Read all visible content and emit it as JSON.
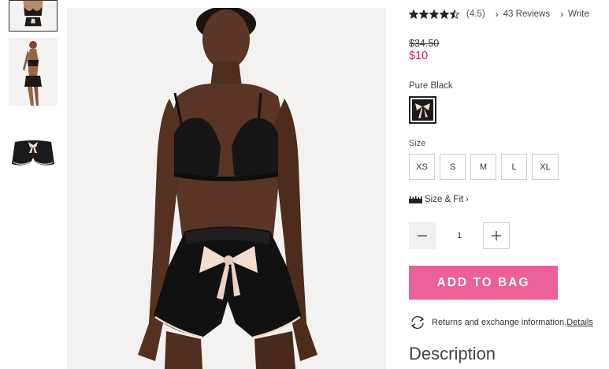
{
  "rating": {
    "value_text": "(4.5)",
    "value": 4.5,
    "reviews_label": "43 Reviews",
    "write_label": "Write"
  },
  "price": {
    "was": "$34.50",
    "now": "$10"
  },
  "color": {
    "label": "Pure Black",
    "swatch_color": "#1b1b1b",
    "bow_color": "#f3ddd0"
  },
  "size": {
    "label": "Size",
    "options": [
      "XS",
      "S",
      "M",
      "L",
      "XL"
    ]
  },
  "fit_label": "Size & Fit",
  "quantity": {
    "value": "1",
    "minus_icon": "minus-icon",
    "plus_icon": "plus-icon"
  },
  "add_to_bag_label": "ADD TO BAG",
  "returns": {
    "text": "Returns and exchange information.",
    "link": "Details"
  },
  "description_heading": "Description",
  "colors": {
    "accent": "#ec6097",
    "sale_price": "#d31f54"
  }
}
